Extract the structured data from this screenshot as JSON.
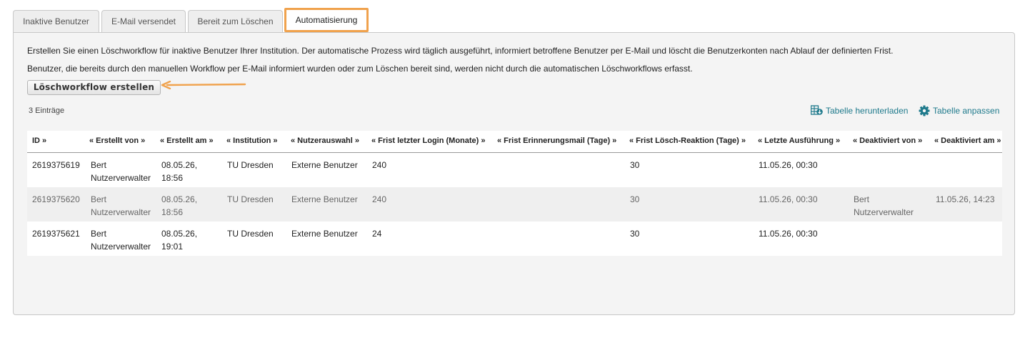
{
  "tabs": [
    {
      "label": "Inaktive Benutzer",
      "active": false
    },
    {
      "label": "E-Mail versendet",
      "active": false
    },
    {
      "label": "Bereit zum Löschen",
      "active": false
    },
    {
      "label": "Automatisierung",
      "active": true
    }
  ],
  "intro": {
    "line1": "Erstellen Sie einen Löschworkflow für inaktive Benutzer Ihrer Institution. Der automatische Prozess wird täglich ausgeführt, informiert betroffene Benutzer per E-Mail und löscht die Benutzerkonten nach Ablauf der definierten Frist.",
    "line2": "Benutzer, die bereits durch den manuellen Workflow per E-Mail informiert wurden oder zum Löschen bereit sind, werden nicht durch die automatischen Löschworkflows erfasst."
  },
  "create_button": "Löschworkflow erstellen",
  "entries_count": "3 Einträge",
  "toolbar": {
    "download": "Tabelle herunterladen",
    "customize": "Tabelle anpassen"
  },
  "colors": {
    "accent": "#f0a24d",
    "link": "#1f7a8c"
  },
  "table": {
    "headers": [
      "ID »",
      "« Erstellt von »",
      "« Erstellt am »",
      "« Institution »",
      "« Nutzerauswahl »",
      "« Frist letzter Login (Monate) »",
      "« Frist Erinnerungsmail (Tage) »",
      "« Frist Lösch-Reaktion (Tage) »",
      "« Letzte Ausführung »",
      "« Deaktiviert von »",
      "« Deaktiviert am »"
    ],
    "rows": [
      {
        "id": "2619375619",
        "created_by": [
          "Bert",
          "Nutzerverwalter"
        ],
        "created_at": [
          "08.05.26,",
          "18:56"
        ],
        "institution": "TU Dresden",
        "user_selection": "Externe Benutzer",
        "login_months": "240",
        "reminder_days": "",
        "delete_reaction_days": "30",
        "last_run": "11.05.26, 00:30",
        "deactivated_by": [
          "",
          ""
        ],
        "deactivated_at": ""
      },
      {
        "id": "2619375620",
        "created_by": [
          "Bert",
          "Nutzerverwalter"
        ],
        "created_at": [
          "08.05.26,",
          "18:56"
        ],
        "institution": "TU Dresden",
        "user_selection": "Externe Benutzer",
        "login_months": "240",
        "reminder_days": "",
        "delete_reaction_days": "30",
        "last_run": "11.05.26, 00:30",
        "deactivated_by": [
          "Bert",
          "Nutzerverwalter"
        ],
        "deactivated_at": "11.05.26, 14:23"
      },
      {
        "id": "2619375621",
        "created_by": [
          "Bert",
          "Nutzerverwalter"
        ],
        "created_at": [
          "08.05.26,",
          "19:01"
        ],
        "institution": "TU Dresden",
        "user_selection": "Externe Benutzer",
        "login_months": "24",
        "reminder_days": "",
        "delete_reaction_days": "30",
        "last_run": "11.05.26, 00:30",
        "deactivated_by": [
          "",
          ""
        ],
        "deactivated_at": ""
      }
    ]
  }
}
